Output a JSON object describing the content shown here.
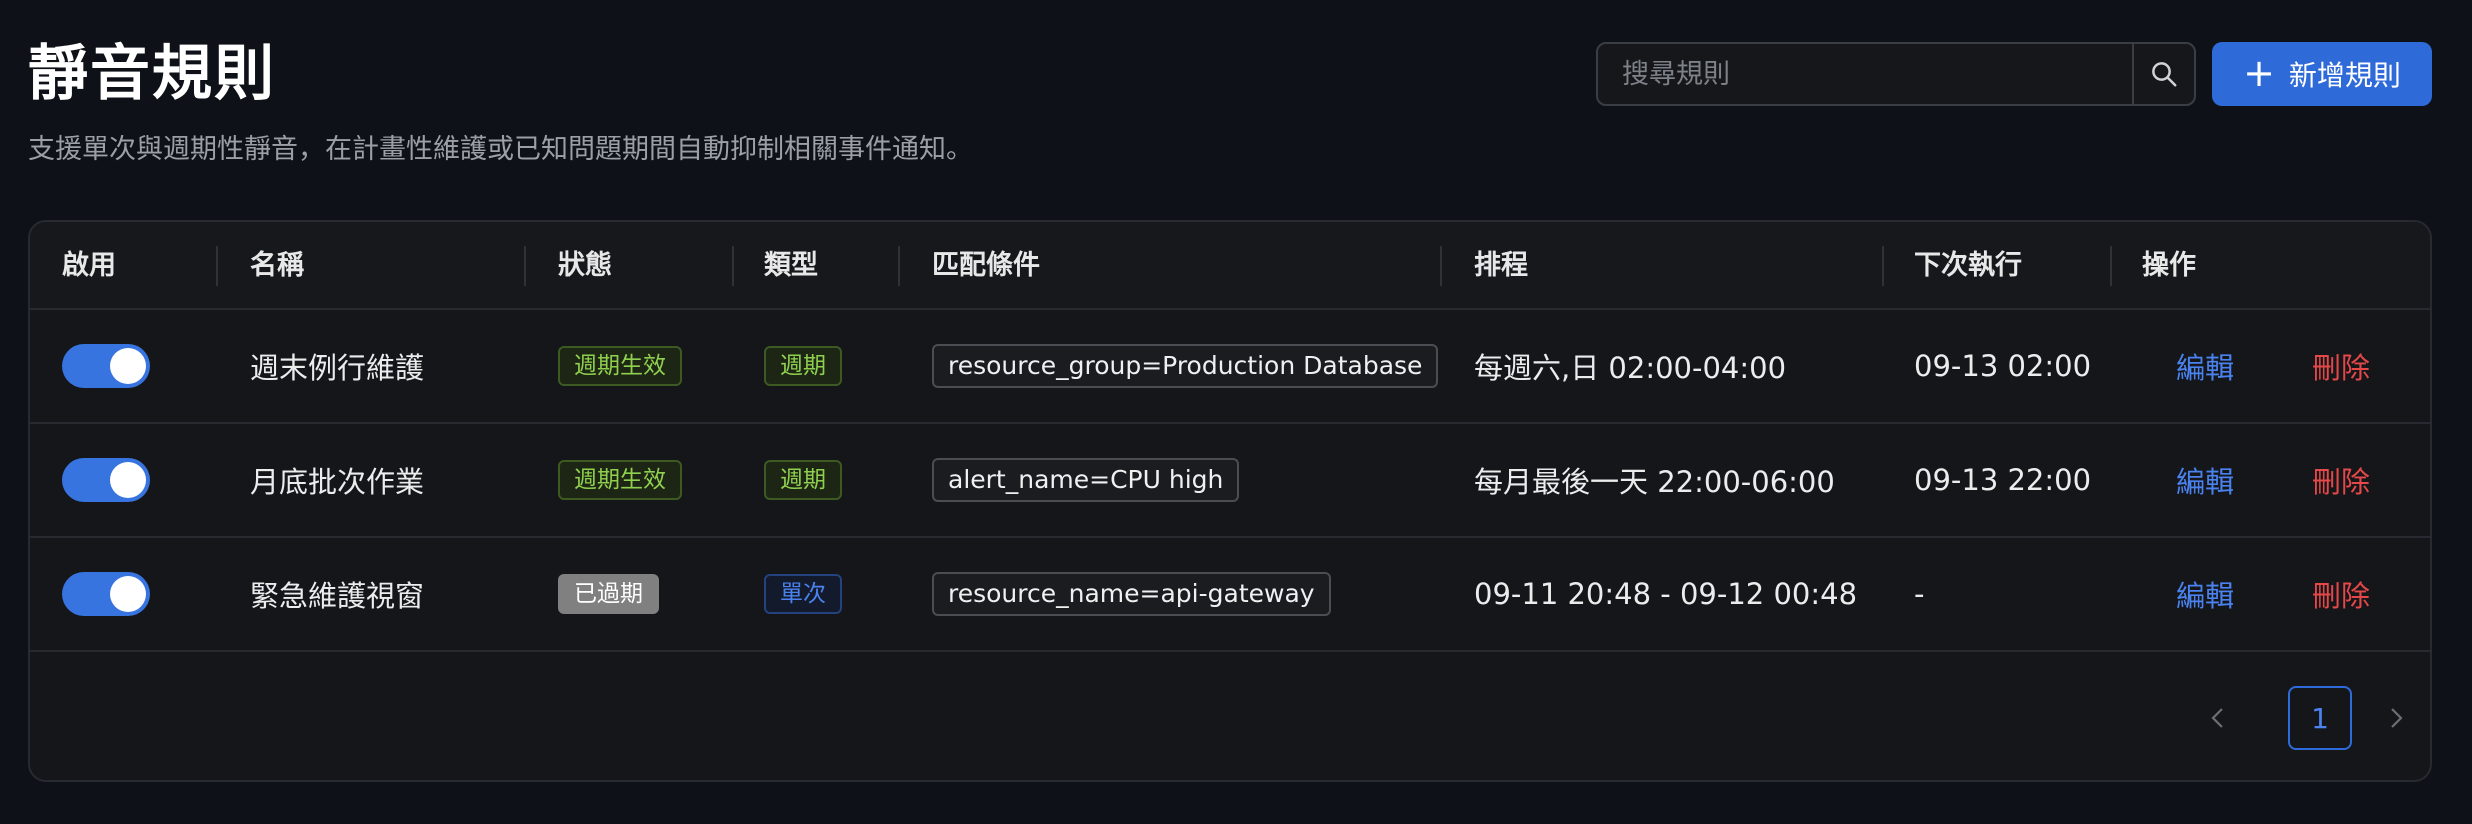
{
  "header": {
    "title": "靜音規則",
    "subtitle": "支援單次與週期性靜音，在計畫性維護或已知問題期間自動抑制相關事件通知。"
  },
  "search": {
    "placeholder": "搜尋規則",
    "value": ""
  },
  "toolbar": {
    "add_label": "新增規則",
    "add_icon": "+"
  },
  "table": {
    "columns": [
      "啟用",
      "名稱",
      "狀態",
      "類型",
      "匹配條件",
      "排程",
      "下次執行",
      "操作"
    ],
    "rows": [
      {
        "enabled": true,
        "name": "週末例行維護",
        "status": "週期生效",
        "type": "週期",
        "match": "resource_group=Production Database",
        "schedule": "每週六,日 02:00-04:00",
        "next_run": "09-13 02:00",
        "edit": "編輯",
        "delete": "刪除"
      },
      {
        "enabled": true,
        "name": "月底批次作業",
        "status": "週期生效",
        "type": "週期",
        "match": "alert_name=CPU high",
        "schedule": "每月最後一天 22:00-06:00",
        "next_run": "09-13 22:00",
        "edit": "編輯",
        "delete": "刪除"
      },
      {
        "enabled": true,
        "name": "緊急維護視窗",
        "status": "已過期",
        "type": "單次",
        "match": "resource_name=api-gateway",
        "schedule": "09-11 20:48 - 09-12 00:48",
        "next_run": "-",
        "edit": "編輯",
        "delete": "刪除"
      }
    ]
  },
  "pagination": {
    "current_page": "1",
    "prev_icon": "chevron-left-icon",
    "next_icon": "chevron-right-icon"
  },
  "colors": {
    "accent": "#2f6ad9",
    "delete": "#e54848",
    "active_tag": "#8fd14f",
    "expired_tag": "#808080"
  }
}
